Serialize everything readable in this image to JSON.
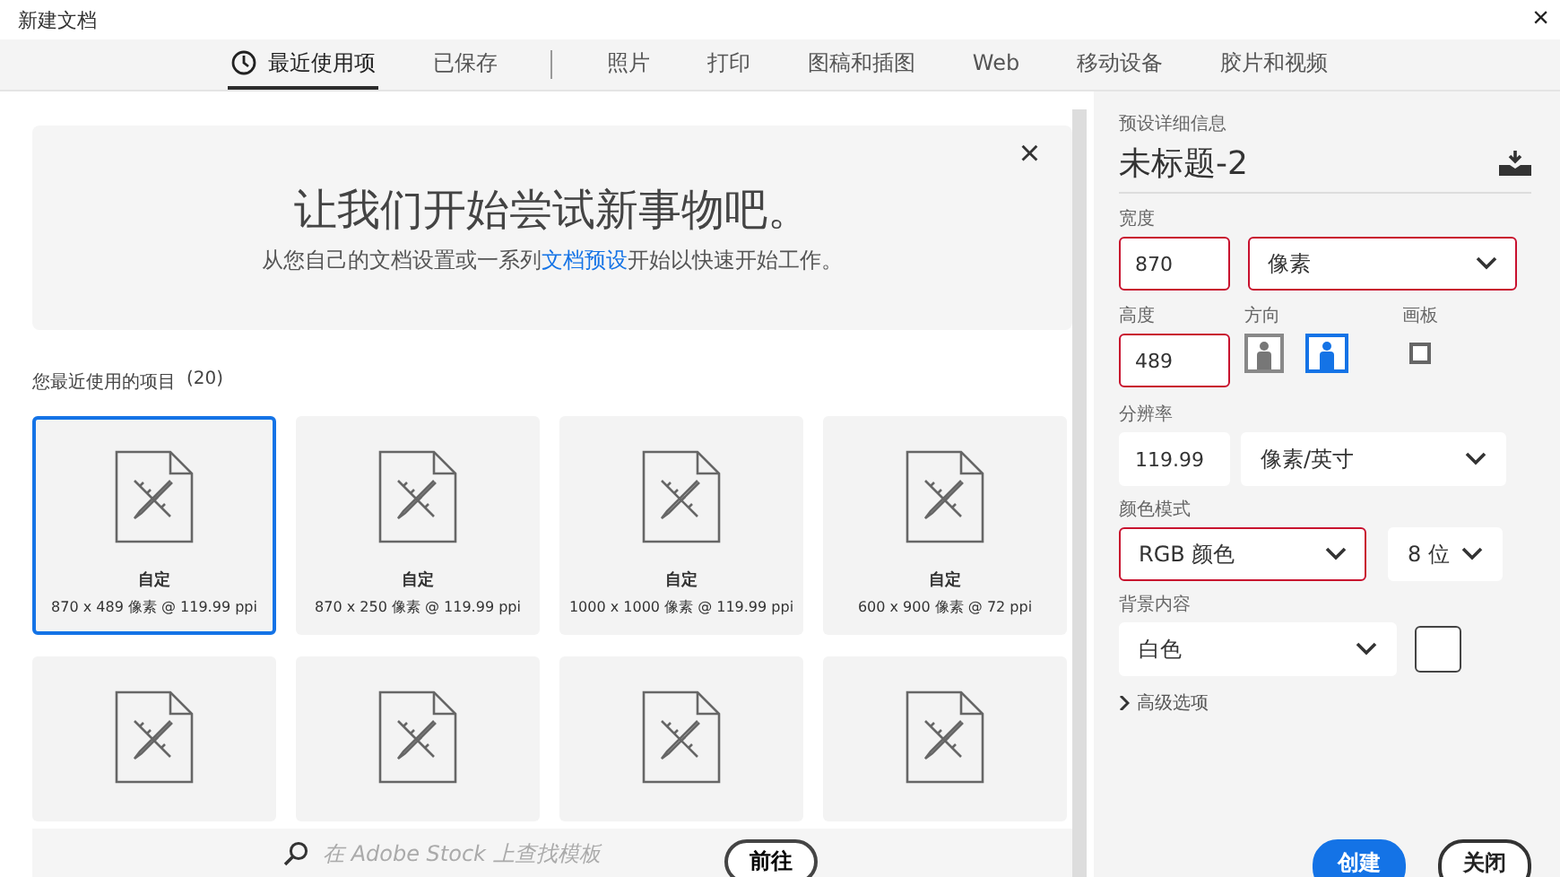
{
  "window": {
    "title": "新建文档",
    "close": "×"
  },
  "tabs": [
    {
      "label": "最近使用项",
      "selected": true,
      "icon": true
    },
    {
      "label": "已保存",
      "selected": false,
      "divider_after": true
    },
    {
      "label": "照片",
      "selected": false
    },
    {
      "label": "打印",
      "selected": false
    },
    {
      "label": "图稿和插图",
      "selected": false
    },
    {
      "label": "Web",
      "selected": false
    },
    {
      "label": "移动设备",
      "selected": false
    },
    {
      "label": "胶片和视频",
      "selected": false
    }
  ],
  "banner": {
    "heading": "让我们开始尝试新事物吧。",
    "text": "从您自己的文档设置或一系列",
    "link": "文档预设",
    "text_after": "开始以快速开始工作。",
    "close": "×"
  },
  "recent": {
    "heading": "您最近使用的项目",
    "count": "(20)",
    "items": [
      {
        "name": "自定",
        "details": "870 x 489 像素 @ 119.99 ppi",
        "selected": true
      },
      {
        "name": "自定",
        "details": "870 x 250 像素 @ 119.99 ppi",
        "selected": false
      },
      {
        "name": "自定",
        "details": "1000 x 1000 像素 @ 119.99 ppi",
        "selected": false
      },
      {
        "name": "自定",
        "details": "600 x 900 像素 @ 72 ppi",
        "selected": false
      },
      {
        "selected": false
      },
      {
        "selected": false
      },
      {
        "selected": false
      },
      {
        "selected": false
      }
    ]
  },
  "stock_search": {
    "placeholder": "在 Adobe Stock 上查找模板",
    "button": "前往"
  },
  "details": {
    "section": "预设详细信息",
    "name": "未标题-2",
    "width": {
      "label": "宽度",
      "value": "870",
      "unit": "像素",
      "highlighted": true,
      "unit_highlighted": true
    },
    "height": {
      "label": "高度",
      "value": "489",
      "highlighted": true
    },
    "orientation": {
      "label": "方向",
      "options": [
        {
          "kind": "portrait",
          "selected": false
        },
        {
          "kind": "landscape",
          "selected": true
        }
      ]
    },
    "artboard": {
      "label": "画板",
      "checked": false
    },
    "resolution": {
      "label": "分辨率",
      "value": "119.99",
      "unit": "像素/英寸"
    },
    "color_mode": {
      "label": "颜色模式",
      "value": "RGB 颜色",
      "depth": "8 位",
      "highlighted": true
    },
    "background": {
      "label": "背景内容",
      "value": "白色",
      "color": "#ffffff"
    },
    "advanced": {
      "label": "高级选项",
      "expanded": false
    }
  },
  "buttons": [
    {
      "label": "创建",
      "kind": "primary"
    },
    {
      "label": "关闭",
      "kind": "secondary"
    }
  ]
}
